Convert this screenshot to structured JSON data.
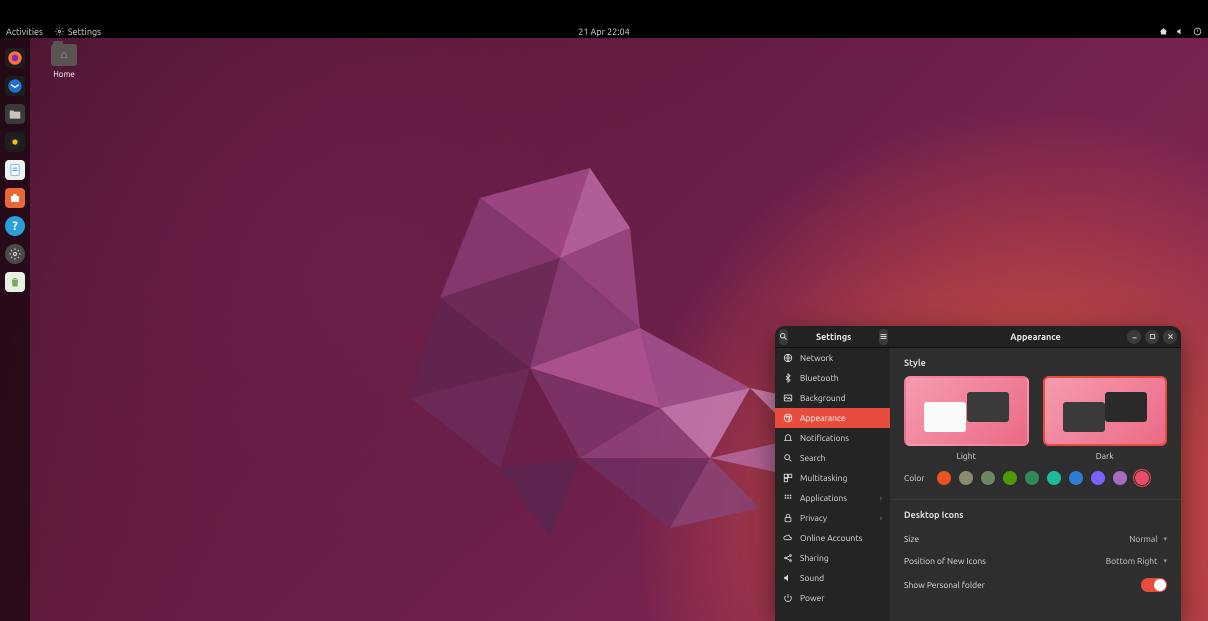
{
  "topbar": {
    "activities": "Activities",
    "app_indicator": "Settings",
    "clock": "21 Apr  22:04"
  },
  "desktop_icons": [
    {
      "name": "home-folder",
      "label": "Home"
    }
  ],
  "dock": [
    {
      "name": "firefox",
      "color": "#ff7139"
    },
    {
      "name": "thunderbird",
      "color": "#1f6fd0"
    },
    {
      "name": "files",
      "color": "#8f8b87"
    },
    {
      "name": "rhythmbox",
      "color": "#f5c211"
    },
    {
      "name": "libreoffice-writer",
      "color": "#1e88e5"
    },
    {
      "name": "software",
      "color": "#eb6637"
    },
    {
      "name": "help",
      "color": "#2aa0d4"
    },
    {
      "name": "settings",
      "color": "#6e6e6e"
    },
    {
      "name": "trash",
      "color": "#9bcf8f"
    }
  ],
  "settings": {
    "window_title_left": "Settings",
    "window_title_right": "Appearance",
    "sidebar": [
      {
        "icon": "globe-icon",
        "label": "Network"
      },
      {
        "icon": "bluetooth-icon",
        "label": "Bluetooth"
      },
      {
        "icon": "background-icon",
        "label": "Background"
      },
      {
        "icon": "appearance-icon",
        "label": "Appearance",
        "active": true
      },
      {
        "icon": "bell-icon",
        "label": "Notifications"
      },
      {
        "icon": "search-icon",
        "label": "Search"
      },
      {
        "icon": "multitask-icon",
        "label": "Multitasking"
      },
      {
        "icon": "apps-icon",
        "label": "Applications",
        "chevron": true
      },
      {
        "icon": "lock-icon",
        "label": "Privacy",
        "chevron": true
      },
      {
        "icon": "cloud-icon",
        "label": "Online Accounts"
      },
      {
        "icon": "share-icon",
        "label": "Sharing"
      },
      {
        "icon": "sound-icon",
        "label": "Sound"
      },
      {
        "icon": "power-icon",
        "label": "Power"
      }
    ],
    "appearance": {
      "style_heading": "Style",
      "styles": [
        {
          "key": "light",
          "label": "Light",
          "selected": false
        },
        {
          "key": "dark",
          "label": "Dark",
          "selected": true
        }
      ],
      "color_label": "Color",
      "colors": [
        {
          "hex": "#e95420",
          "name": "orange"
        },
        {
          "hex": "#8a8a6f",
          "name": "bark"
        },
        {
          "hex": "#6d8764",
          "name": "sage"
        },
        {
          "hex": "#4e9a06",
          "name": "olive"
        },
        {
          "hex": "#2e8b57",
          "name": "viridian"
        },
        {
          "hex": "#1abc9c",
          "name": "prussian-green"
        },
        {
          "hex": "#2d7dd2",
          "name": "blue"
        },
        {
          "hex": "#7b61ff",
          "name": "purple"
        },
        {
          "hex": "#a56cc1",
          "name": "magenta"
        },
        {
          "hex": "#e74c6c",
          "name": "red",
          "selected": true
        }
      ],
      "desktop_icons_heading": "Desktop Icons",
      "size_label": "Size",
      "size_value": "Normal",
      "position_label": "Position of New Icons",
      "position_value": "Bottom Right",
      "show_personal_label": "Show Personal folder",
      "show_personal_value": true
    }
  }
}
